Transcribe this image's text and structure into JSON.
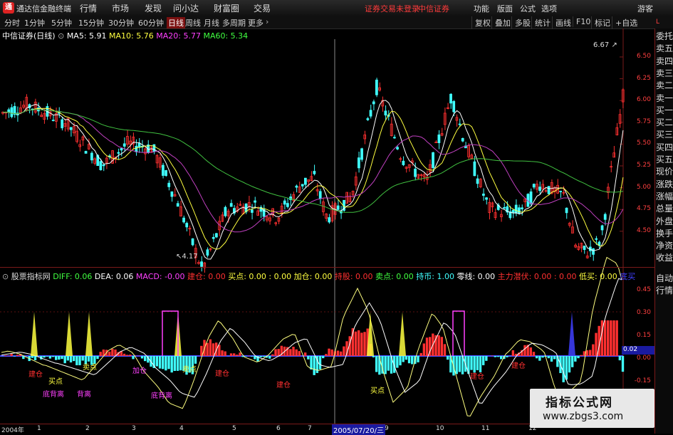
{
  "titlebar": {
    "app_name": "通达信金融终端",
    "menus": [
      "行情",
      "市场",
      "发现",
      "问小达",
      "财富圈",
      "交易"
    ],
    "login_msg": "证券交易未登录",
    "broker": "中信证券",
    "right_menus": [
      "功能",
      "版面",
      "公式",
      "选项"
    ],
    "guest": "游客"
  },
  "toolbar": {
    "periods": [
      "分时",
      "1分钟",
      "5分钟",
      "15分钟",
      "30分钟",
      "60分钟",
      "日线",
      "周线",
      "月线",
      "多周期",
      "更多"
    ],
    "selected": "日线",
    "right_tools": [
      "复权",
      "叠加",
      "多股",
      "统计",
      "画线",
      "F10",
      "标记",
      "+自选"
    ]
  },
  "main_chart": {
    "stock": "中信证券(日线)",
    "ma": [
      {
        "label": "MA5: 5.91",
        "color": "#ffffff"
      },
      {
        "label": "MA10: 5.76",
        "color": "#ffff40"
      },
      {
        "label": "MA20: 5.77",
        "color": "#ff40ff"
      },
      {
        "label": "MA60: 5.34",
        "color": "#40ff40"
      }
    ],
    "y_ticks": [
      "6.50",
      "6.25",
      "6.00",
      "5.75",
      "5.50",
      "5.25",
      "5.00",
      "4.75",
      "4.50"
    ],
    "high_label": "6.67",
    "low_label": "4.17"
  },
  "indicator": {
    "name": "股票指标网",
    "items": [
      {
        "label": "DIFF: 0.06",
        "color": "#40ff40"
      },
      {
        "label": "DEA: 0.06",
        "color": "#ffffff"
      },
      {
        "label": "MACD: -0.00",
        "color": "#ff40ff"
      },
      {
        "label": "建仓: 0.00",
        "color": "#ff3030"
      },
      {
        "label": "买点: 0.00",
        "color": "#ffff40"
      },
      {
        "label": ": 0.00",
        "color": "#ffff40"
      },
      {
        "label": "加仓: 0.00",
        "color": "#ffff40"
      },
      {
        "label": "持股: 0.00",
        "color": "#ff3030"
      },
      {
        "label": "卖点: 0.00",
        "color": "#40ff40"
      },
      {
        "label": "持币: 1.00",
        "color": "#40ffff"
      },
      {
        "label": "零线: 0.00",
        "color": "#ffffff"
      },
      {
        "label": "主力潜伏: 0.00",
        "color": "#ff3030"
      },
      {
        "label": ": 0.00",
        "color": "#ff3030"
      },
      {
        "label": "低买: 0.00",
        "color": "#ffff40"
      },
      {
        "label": "底买",
        "color": "#4040ff"
      }
    ],
    "y_ticks": [
      "0.45",
      "0.30",
      "0.15",
      "0.00",
      "-0.15"
    ],
    "current_value": "0.02",
    "signal_labels": [
      "背离",
      "卖点",
      "加仓",
      "建仓",
      "买点",
      "底背离",
      "底背离",
      "建仓",
      "建仓",
      "卖点",
      "买点",
      "建仓",
      "建仓"
    ]
  },
  "bottom_axis": {
    "labels": [
      "2004年",
      "1",
      "2",
      "3",
      "4",
      "5",
      "6",
      "7",
      "8",
      "9",
      "10",
      "11",
      "12"
    ],
    "cursor_date": "2005/07/20/三"
  },
  "right_panel": {
    "items": [
      "委托",
      "卖五",
      "卖四",
      "卖三",
      "卖二",
      "卖一",
      "买一",
      "买二",
      "买三",
      "买四",
      "买五",
      "现价",
      "涨跌",
      "涨幅",
      "总量",
      "外盘",
      "换手",
      "净资",
      "收益"
    ],
    "bottom_items": [
      "自动",
      "行情"
    ]
  },
  "watermark": {
    "title": "指标公式网",
    "url": "www.zbgs3.com"
  },
  "colors": {
    "up": "#ff3030",
    "down": "#40ffff",
    "accent": "#7a1010"
  }
}
